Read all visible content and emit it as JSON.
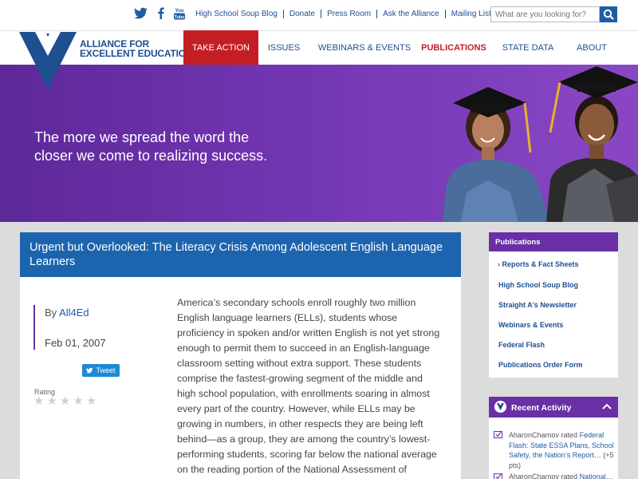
{
  "top_links": [
    "High School Soup Blog",
    "Donate",
    "Press Room",
    "Ask the Alliance",
    "Mailing List"
  ],
  "search": {
    "placeholder": "What are you looking for?"
  },
  "social": {
    "youtube_label_1": "You",
    "youtube_label_2": "Tube"
  },
  "logo": {
    "line1": "ALLIANCE FOR",
    "line2": "EXCELLENT EDUCATION"
  },
  "nav": {
    "take_action": "TAKE ACTION",
    "issues": "ISSUES",
    "webinars": "WEBINARS & EVENTS",
    "publications": "PUBLICATIONS",
    "state_data": "STATE DATA",
    "about": "ABOUT"
  },
  "hero": {
    "line1": "The more we spread the word the",
    "line2": "closer we come to realizing success."
  },
  "article": {
    "title": "Urgent but Overlooked: The Literacy Crisis Among Adolescent English Language Learners",
    "by_prefix": "By",
    "author": "All4Ed",
    "date": "Feb 01, 2007",
    "tweet_label": "Tweet",
    "rating_label": "Rating",
    "body": "America’s secondary schools enroll roughly two million English language learners (ELLs), students whose proficiency in spoken and/or written English is not yet strong enough to permit them to succeed in an English-language classroom setting without extra support. These students comprise the fastest-growing segment of the middle and high school population, with enrollments soaring in almost every part of the country. However, while ELLs may be growing in numbers, in other respects they are being left behind—as a group, they are among the country’s lowest-performing students, scoring far below the national average on the reading portion of the National Assessment of Educational Progress. This Issue Brief"
  },
  "sidebar": {
    "publications_title": "Publications",
    "items": [
      "Reports & Fact Sheets",
      "High School Soup Blog",
      "Straight A's Newsletter",
      "Webinars & Events",
      "Federal Flash",
      "Publications Order Form"
    ],
    "recent_title": "Recent Activity",
    "activity_1_user": "AharonCharnov rated",
    "activity_1_item": "Federal Flash: State ESSA Plans, School Safety, the Nation’s Report…",
    "activity_1_points": "(+5 pts)",
    "activity_2_user": "AharonCharnov rated",
    "activity_2_item": "National…"
  },
  "colors": {
    "purple": "#6a2fa6",
    "blue": "#1d64ae",
    "red": "#c41e25",
    "navy": "#1d4f91"
  }
}
